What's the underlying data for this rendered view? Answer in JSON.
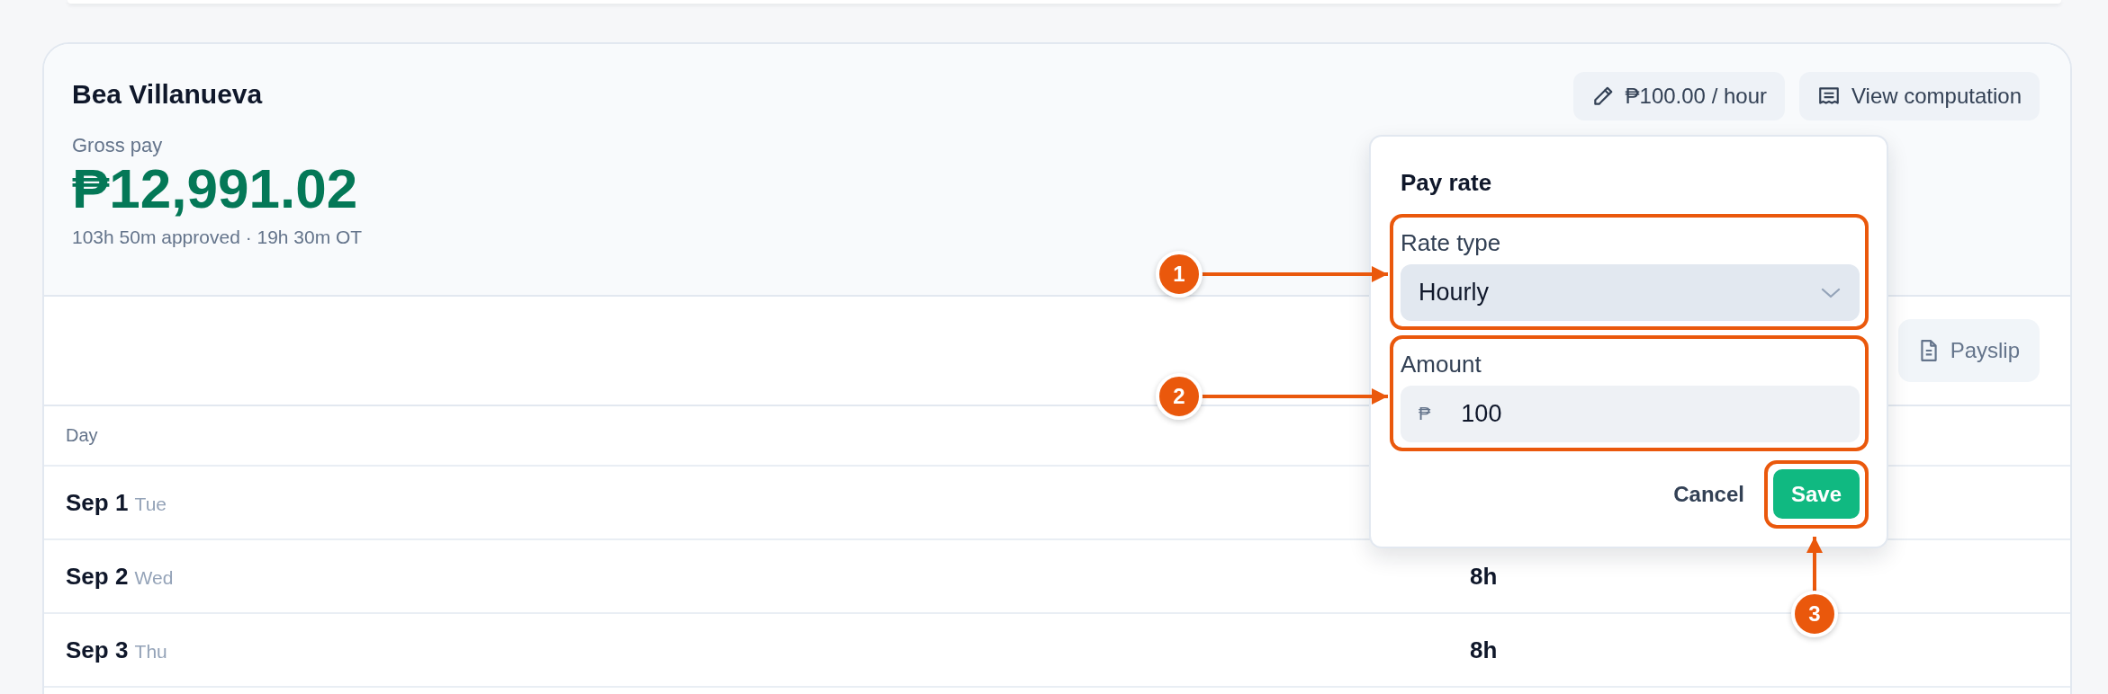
{
  "employee": {
    "name": "Bea Villanueva",
    "gross_pay_label": "Gross pay",
    "gross_pay": "₱12,991.02",
    "summary": "103h 50m approved · 19h 30m OT",
    "rate_button": "₱100.00 / hour",
    "computation_button": "View computation",
    "payslip_button": "Payslip"
  },
  "table": {
    "columns": [
      "Day"
    ],
    "rows": [
      {
        "date": "Sep 1",
        "weekday": "Tue"
      },
      {
        "date": "Sep 2",
        "weekday": "Wed",
        "hours": "8h"
      },
      {
        "date": "Sep 3",
        "weekday": "Thu",
        "hours": "8h"
      }
    ]
  },
  "pay_rate_popover": {
    "title": "Pay rate",
    "rate_type": {
      "label": "Rate type",
      "value": "Hourly"
    },
    "amount": {
      "label": "Amount",
      "prefix": "₱",
      "value": "100"
    },
    "buttons": [
      {
        "label": "Cancel",
        "kind": "secondary"
      },
      {
        "label": "Save",
        "kind": "primary"
      }
    ]
  },
  "annotations": [
    {
      "number": "1"
    },
    {
      "number": "2"
    },
    {
      "number": "3"
    }
  ]
}
